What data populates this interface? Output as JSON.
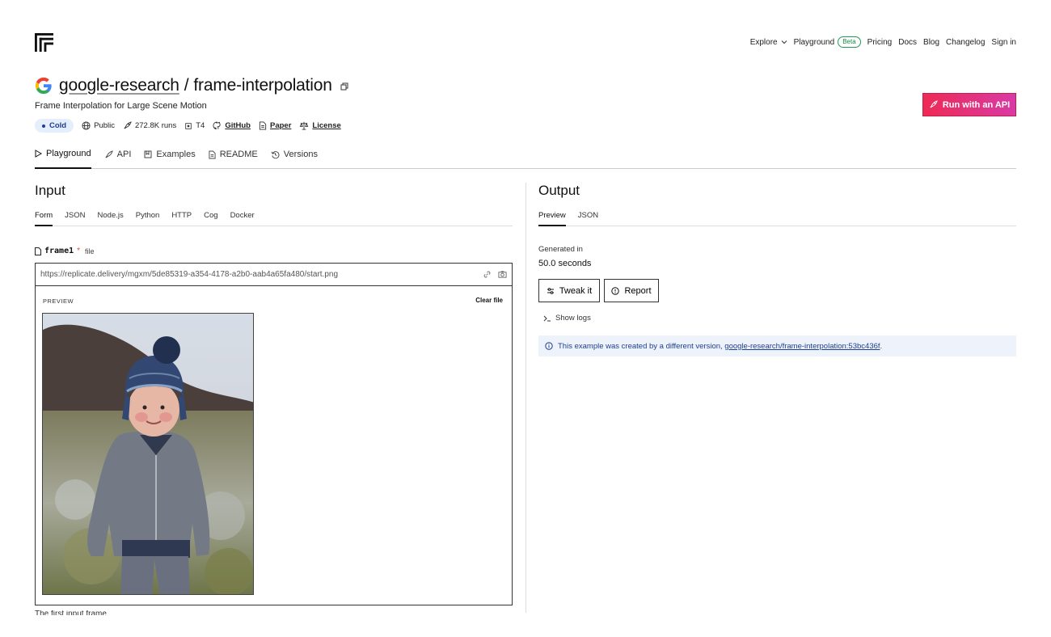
{
  "nav": {
    "explore": "Explore",
    "playground": "Playground",
    "beta": "Beta",
    "pricing": "Pricing",
    "docs": "Docs",
    "blog": "Blog",
    "changelog": "Changelog",
    "signin": "Sign in"
  },
  "model": {
    "owner": "google-research",
    "separator": "/",
    "name": "frame-interpolation",
    "description": "Frame Interpolation for Large Scene Motion",
    "status": "Cold",
    "visibility": "Public",
    "runs": "272.8K runs",
    "hardware": "T4",
    "github": "GitHub",
    "paper": "Paper",
    "license": "License"
  },
  "run_api_label": "Run with an API",
  "tabs": [
    {
      "label": "Playground",
      "icon": "play-icon"
    },
    {
      "label": "API",
      "icon": "rocket-icon"
    },
    {
      "label": "Examples",
      "icon": "bookmark-icon"
    },
    {
      "label": "README",
      "icon": "document-icon"
    },
    {
      "label": "Versions",
      "icon": "history-icon"
    }
  ],
  "input": {
    "title": "Input",
    "subtabs": [
      "Form",
      "JSON",
      "Node.js",
      "Python",
      "HTTP",
      "Cog",
      "Docker"
    ],
    "field": {
      "name": "frame1",
      "required": "*",
      "type": "file",
      "value": "https://replicate.delivery/mgxm/5de85319-a354-4178-a2b0-aab4a65fa480/start.png",
      "preview_label": "PREVIEW",
      "clear_label": "Clear file"
    },
    "cut_text": "The first input frame"
  },
  "output": {
    "title": "Output",
    "subtabs": [
      "Preview",
      "JSON"
    ],
    "generated_label": "Generated in",
    "generated_value": "50.0 seconds",
    "tweak_label": "Tweak it",
    "report_label": "Report",
    "logs_label": "Show logs",
    "notice_text": "This example was created by a different version,",
    "notice_link": "google-research/frame-interpolation:53bc436f",
    "notice_end": "."
  },
  "colors": {
    "accent_start": "#ee2a55",
    "accent_end": "#d93aa6",
    "beta_green": "#1f9d55",
    "notice_bg": "#eef3fb",
    "cold_bg": "#e5eefc"
  }
}
